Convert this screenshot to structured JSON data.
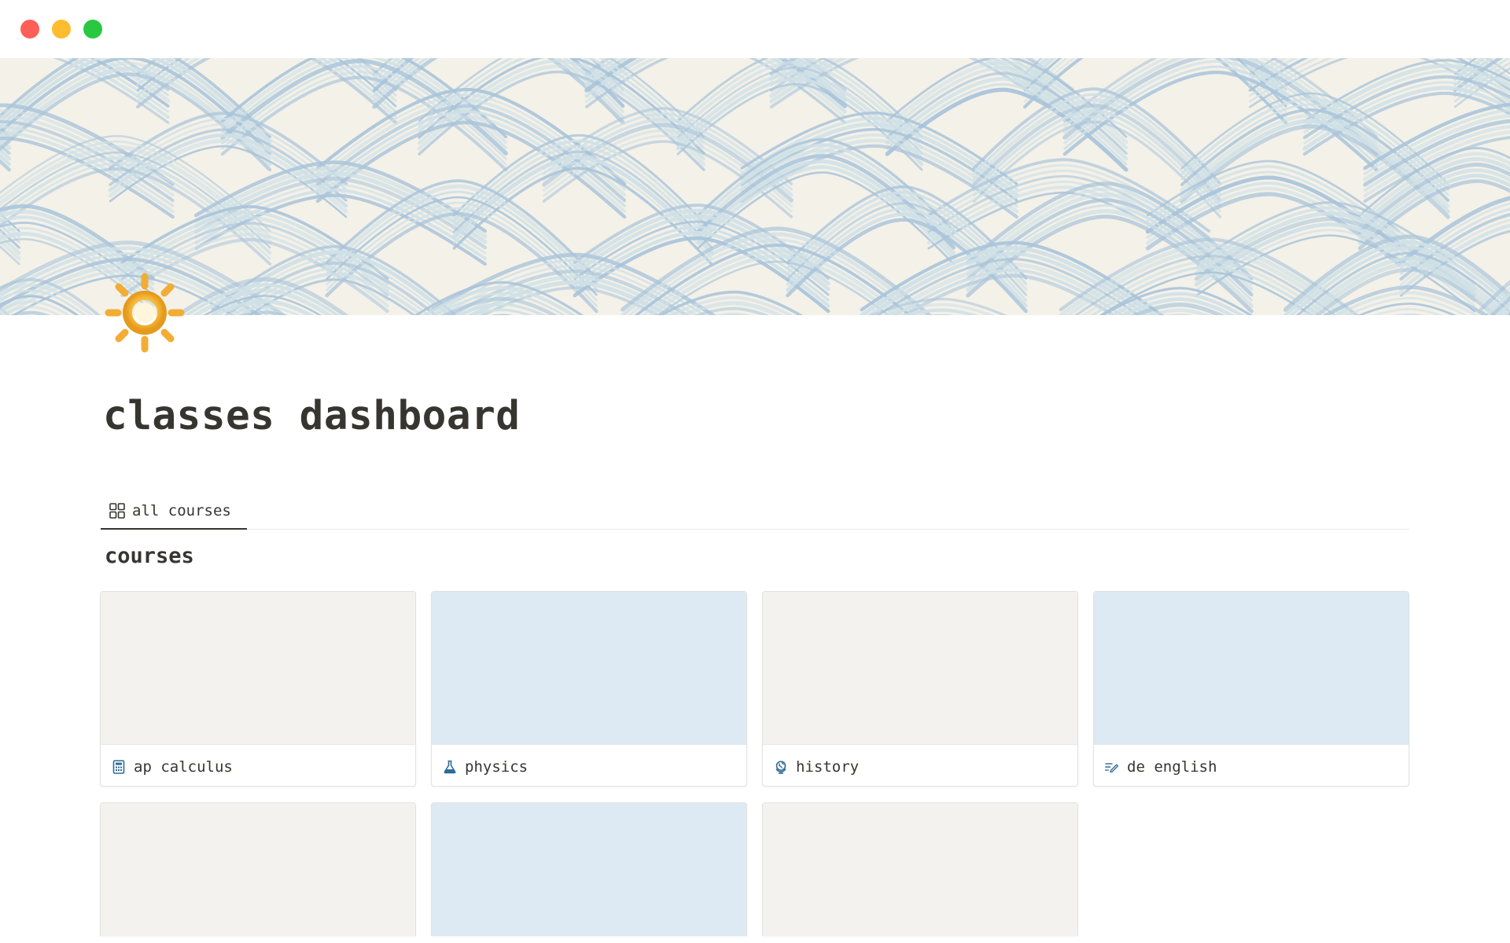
{
  "window": {
    "controls": [
      "close",
      "minimize",
      "maximize"
    ]
  },
  "page": {
    "icon": "sun-icon",
    "title": "classes dashboard",
    "cover_colors": {
      "paper": "#f4f1e8",
      "wave_light": "#cfe0e6",
      "wave_dark": "#a9c4da"
    }
  },
  "views": {
    "tabs": [
      {
        "label": "all courses",
        "icon": "gallery-icon",
        "active": true
      }
    ]
  },
  "gallery": {
    "title": "courses",
    "cards": [
      {
        "label": "ap calculus",
        "icon": "calculator-icon",
        "cover": "#f3f2ee"
      },
      {
        "label": "physics",
        "icon": "flask-icon",
        "cover": "#dde9f3"
      },
      {
        "label": "history",
        "icon": "globe-icon",
        "cover": "#f3f2ee"
      },
      {
        "label": "de english",
        "icon": "writing-icon",
        "cover": "#dde9f3"
      },
      {
        "label": "",
        "icon": "",
        "cover": "#f3f2ee"
      },
      {
        "label": "",
        "icon": "",
        "cover": "#dde9f3"
      },
      {
        "label": "",
        "icon": "",
        "cover": "#f3f2ee"
      }
    ]
  },
  "colors": {
    "text": "#37352f",
    "icon_blue": "#2e6b96",
    "traffic_red": "#ff5f57",
    "traffic_yellow": "#febc2e",
    "traffic_green": "#28c840"
  }
}
